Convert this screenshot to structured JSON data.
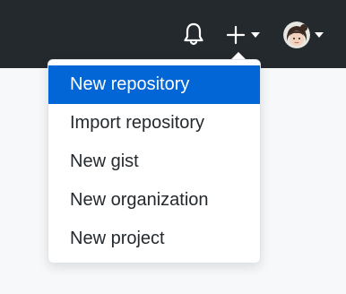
{
  "header": {
    "icons": {
      "notifications": "bell-icon",
      "create": "plus-icon",
      "create_caret": "caret-down-icon",
      "profile_caret": "caret-down-icon"
    }
  },
  "create_menu": {
    "items": [
      {
        "label": "New repository",
        "active": true
      },
      {
        "label": "Import repository",
        "active": false
      },
      {
        "label": "New gist",
        "active": false
      },
      {
        "label": "New organization",
        "active": false
      },
      {
        "label": "New project",
        "active": false
      }
    ]
  },
  "colors": {
    "header_bg": "#24292e",
    "active_item_bg": "#0366d6",
    "active_item_text": "#ffffff",
    "item_text": "#24292e",
    "page_bg": "#f6f8fa"
  }
}
